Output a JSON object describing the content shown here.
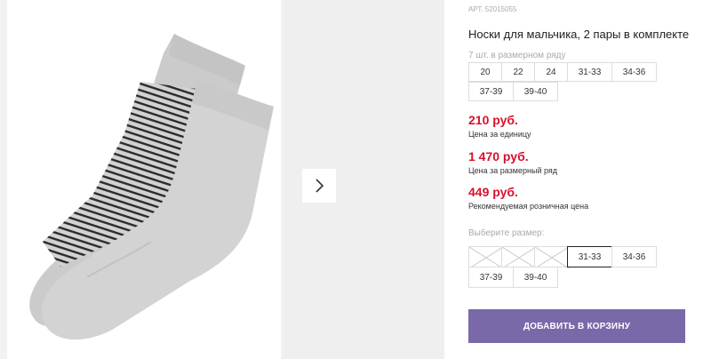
{
  "product": {
    "article": "АРТ. 52015055",
    "title": "Носки для мальчика, 2 пары в комплекте",
    "sizes_in_row_text": "7 шт. в размерном ряду",
    "row_sizes": [
      "20",
      "22",
      "24",
      "31-33",
      "34-36",
      "37-39",
      "39-40"
    ]
  },
  "prices": {
    "unit_price": "210 руб.",
    "unit_label": "Цена за единицу",
    "row_price": "1 470 руб.",
    "row_label": "Цена за размерный ряд",
    "recommended_price": "449 руб.",
    "recommended_label": "Рекомендуемая розничная цена"
  },
  "size_picker": {
    "label": "Выберите размер:",
    "options": [
      {
        "label": "",
        "state": "disabled"
      },
      {
        "label": "",
        "state": "disabled"
      },
      {
        "label": "",
        "state": "disabled"
      },
      {
        "label": "31-33",
        "state": "selected"
      },
      {
        "label": "34-36",
        "state": "available"
      },
      {
        "label": "37-39",
        "state": "available"
      },
      {
        "label": "39-40",
        "state": "available"
      }
    ]
  },
  "cart": {
    "add_label": "ДОБАВИТЬ В КОРЗИНУ"
  },
  "colors": {
    "price": "#d8102c",
    "button": "#7a69a8"
  },
  "gallery": {
    "next_icon": "chevron-right-icon"
  }
}
